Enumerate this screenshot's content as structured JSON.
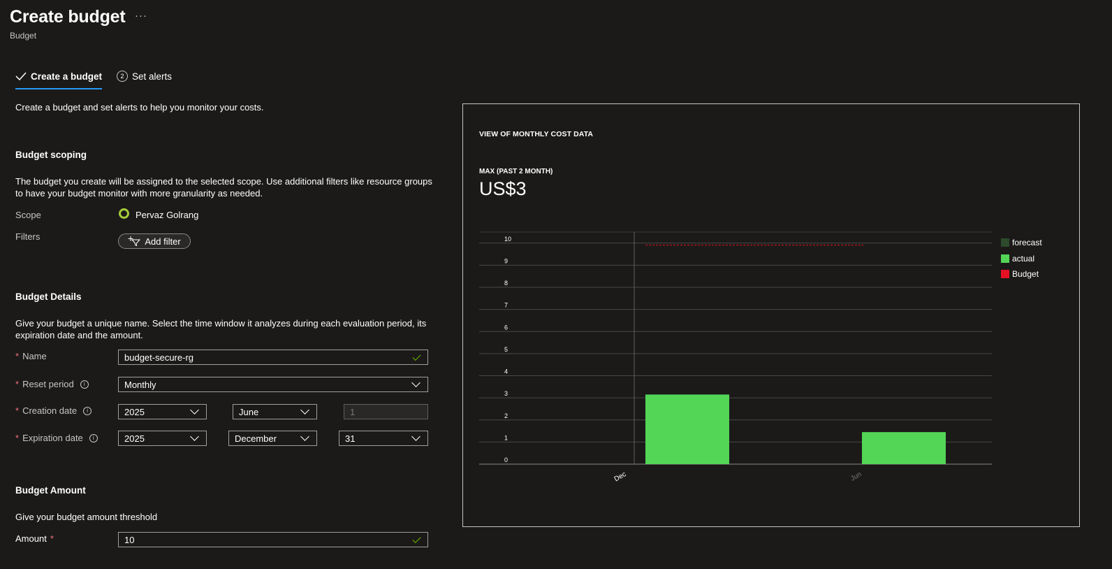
{
  "header": {
    "title": "Create budget",
    "more": "···",
    "subtitle": "Budget"
  },
  "tabs": [
    {
      "label": "Create a budget",
      "state": "completed"
    },
    {
      "label": "Set alerts",
      "step": "2"
    }
  ],
  "intro": "Create a budget and set alerts to help you monitor your costs.",
  "scoping": {
    "heading": "Budget scoping",
    "description": "The budget you create will be assigned to the selected scope. Use additional filters like resource groups to have your budget monitor with more granularity as needed.",
    "scope_label": "Scope",
    "scope_value": "Pervaz Golrang",
    "filters_label": "Filters",
    "add_filter_label": "Add filter"
  },
  "details": {
    "heading": "Budget Details",
    "description": "Give your budget a unique name. Select the time window it analyzes during each evaluation period, its expiration date and the amount.",
    "name_label": "Name",
    "name_value": "budget-secure-rg",
    "reset_label": "Reset period",
    "reset_value": "Monthly",
    "creation_label": "Creation date",
    "creation_year": "2025",
    "creation_month": "June",
    "creation_day": "1",
    "expiration_label": "Expiration date",
    "expiration_year": "2025",
    "expiration_month": "December",
    "expiration_day": "31"
  },
  "amount": {
    "heading": "Budget Amount",
    "description": "Give your budget amount threshold",
    "label": "Amount",
    "value": "10"
  },
  "panel": {
    "title": "VIEW OF MONTHLY COST DATA",
    "max_label": "MAX (PAST 2 MONTH)",
    "max_value": "US$3"
  },
  "colors": {
    "accent": "#2899f5",
    "forecast": "#2d4a2b",
    "actual": "#53d556",
    "budget": "#e81123",
    "scope_dot": "#a4cc39",
    "valid_check": "#6bb700"
  },
  "chart_data": {
    "type": "bar",
    "categories": [
      "Dec",
      "Jun"
    ],
    "series": [
      {
        "name": "forecast",
        "values": [
          0,
          0
        ]
      },
      {
        "name": "actual",
        "values": [
          3.15,
          1.45
        ]
      },
      {
        "name": "Budget",
        "values": [
          10,
          10
        ]
      }
    ],
    "yticks": [
      "0",
      "1",
      "2",
      "3",
      "4",
      "5",
      "6",
      "7",
      "8",
      "9",
      "10"
    ],
    "ylim": [
      0,
      10.5
    ],
    "grid": true,
    "legend": "right",
    "legend_entries": [
      "forecast",
      "actual",
      "Budget"
    ]
  }
}
